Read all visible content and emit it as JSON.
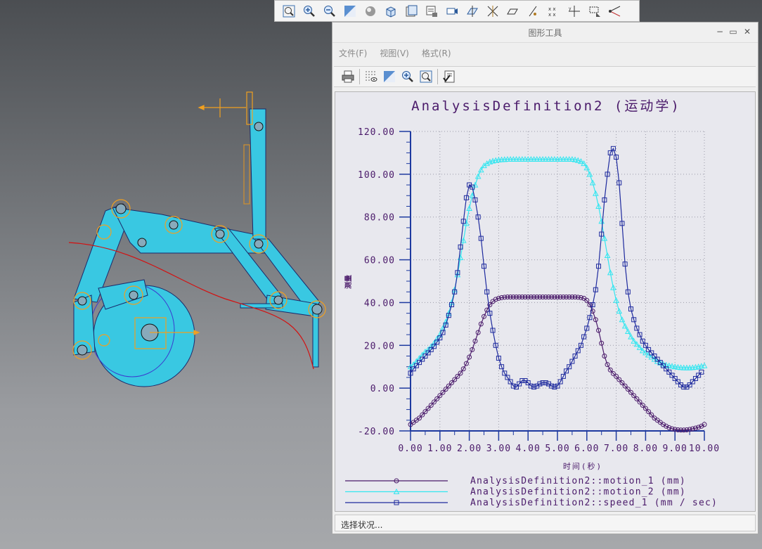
{
  "window": {
    "title": "图形工具",
    "menus": [
      "文件(F)",
      "视图(V)",
      "格式(R)"
    ],
    "status": "选择状况..."
  },
  "icons": {
    "top_toolbar": [
      "zoom-fit-icon",
      "zoom-in-icon",
      "zoom-out-icon",
      "repaint-icon",
      "shading-icon",
      "view-cube-icon",
      "saved-views-icon",
      "layers-icon",
      "camera-icon",
      "plane-display-icon",
      "axis-display-icon",
      "point-display-icon",
      "csys-display-icon",
      "annotation-display-icon",
      "spin-center-icon",
      "cut-icon",
      "vertex-icon",
      "triangle-icon",
      "blend-icon"
    ],
    "graph_toolbar": [
      "print-icon",
      "grid-icon",
      "repaint-icon",
      "zoom-in-icon",
      "refit-icon",
      "format-icon"
    ]
  },
  "chart_data": {
    "type": "line",
    "title": "AnalysisDefinition2 (运动学)",
    "xlabel": "时间(秒)",
    "ylabel": "测量",
    "xlim": [
      0,
      10
    ],
    "ylim": [
      -20,
      120
    ],
    "x_ticks": [
      "0.00",
      "1.00",
      "2.00",
      "3.00",
      "4.00",
      "5.00",
      "6.00",
      "7.00",
      "8.00",
      "9.00",
      "10.00"
    ],
    "y_ticks": [
      "-20.00",
      "0.00",
      "20.00",
      "40.00",
      "60.00",
      "80.00",
      "100.00",
      "120.00"
    ],
    "grid": true,
    "legend_position": "bottom",
    "x": [
      0,
      0.1,
      0.2,
      0.3,
      0.4,
      0.5,
      0.6,
      0.7,
      0.8,
      0.9,
      1.0,
      1.1,
      1.2,
      1.3,
      1.4,
      1.5,
      1.6,
      1.7,
      1.8,
      1.9,
      2.0,
      2.1,
      2.2,
      2.3,
      2.4,
      2.5,
      2.6,
      2.7,
      2.8,
      2.9,
      3.0,
      3.1,
      3.2,
      3.3,
      3.4,
      3.5,
      3.6,
      3.7,
      3.8,
      3.9,
      4.0,
      4.1,
      4.2,
      4.3,
      4.4,
      4.5,
      4.6,
      4.7,
      4.8,
      4.9,
      5.0,
      5.1,
      5.2,
      5.3,
      5.4,
      5.5,
      5.6,
      5.7,
      5.8,
      5.9,
      6.0,
      6.1,
      6.2,
      6.3,
      6.4,
      6.5,
      6.6,
      6.7,
      6.8,
      6.9,
      7.0,
      7.1,
      7.2,
      7.3,
      7.4,
      7.5,
      7.6,
      7.7,
      7.8,
      7.9,
      8.0,
      8.1,
      8.2,
      8.3,
      8.4,
      8.5,
      8.6,
      8.7,
      8.8,
      8.9,
      9.0,
      9.1,
      9.2,
      9.3,
      9.4,
      9.5,
      9.6,
      9.7,
      9.8,
      9.9,
      10.0
    ],
    "series": [
      {
        "name": "AnalysisDefinition2::motion_1 (mm)",
        "color": "#4a1a6a",
        "marker": "circle",
        "values": [
          -17.0,
          -16.0,
          -15.0,
          -14.0,
          -12.5,
          -11.0,
          -9.5,
          -8.0,
          -6.5,
          -5.0,
          -3.5,
          -2.0,
          -0.5,
          1.0,
          2.5,
          4.0,
          5.5,
          7.0,
          9.0,
          11.5,
          14.5,
          18.0,
          22.0,
          26.0,
          30.0,
          33.5,
          36.5,
          39.0,
          40.5,
          41.5,
          42.0,
          42.3,
          42.5,
          42.6,
          42.6,
          42.6,
          42.6,
          42.6,
          42.6,
          42.6,
          42.6,
          42.6,
          42.6,
          42.6,
          42.6,
          42.6,
          42.6,
          42.6,
          42.6,
          42.6,
          42.6,
          42.6,
          42.6,
          42.6,
          42.6,
          42.6,
          42.6,
          42.5,
          42.3,
          42.0,
          41.0,
          39.0,
          36.0,
          32.0,
          27.0,
          21.0,
          15.0,
          11.0,
          8.5,
          6.8,
          5.5,
          4.0,
          2.5,
          1.0,
          -0.5,
          -2.0,
          -3.5,
          -5.0,
          -6.5,
          -8.0,
          -9.5,
          -11.0,
          -12.5,
          -14.0,
          -15.0,
          -16.0,
          -17.0,
          -17.8,
          -18.5,
          -19.0,
          -19.3,
          -19.5,
          -19.6,
          -19.6,
          -19.5,
          -19.3,
          -19.0,
          -18.7,
          -18.3,
          -17.8,
          -17.0
        ]
      },
      {
        "name": "AnalysisDefinition2::motion_2 (mm)",
        "color": "#33e6f0",
        "marker": "triangle",
        "values": [
          10.0,
          11.0,
          12.5,
          14.0,
          15.5,
          17.0,
          18.0,
          19.5,
          21.0,
          23.0,
          25.0,
          28.0,
          31.0,
          35.0,
          40.0,
          46.0,
          53.0,
          61.0,
          69.0,
          77.0,
          84.0,
          90.0,
          95.0,
          99.0,
          102.0,
          104.0,
          105.0,
          105.8,
          106.2,
          106.5,
          106.7,
          106.8,
          106.9,
          107.0,
          107.0,
          107.0,
          107.0,
          107.0,
          107.0,
          107.0,
          107.0,
          107.0,
          107.0,
          107.0,
          107.0,
          107.0,
          107.0,
          107.0,
          107.0,
          107.0,
          107.0,
          107.0,
          107.0,
          107.0,
          107.0,
          107.0,
          106.8,
          106.5,
          106.0,
          105.0,
          103.0,
          100.0,
          96.0,
          91.0,
          85.0,
          78.0,
          70.0,
          62.0,
          54.0,
          47.0,
          41.0,
          36.0,
          32.0,
          29.0,
          26.5,
          24.0,
          22.0,
          20.5,
          19.0,
          17.5,
          16.5,
          15.5,
          14.5,
          13.5,
          12.5,
          11.8,
          11.2,
          10.8,
          10.5,
          10.3,
          10.0,
          9.8,
          9.6,
          9.5,
          9.5,
          9.5,
          9.6,
          9.8,
          10.0,
          10.3,
          10.5
        ]
      },
      {
        "name": "AnalysisDefinition2::speed_1 (mm / sec)",
        "color": "#1e2a9e",
        "marker": "square",
        "values": [
          7.0,
          9.0,
          10.5,
          12.0,
          13.5,
          15.0,
          16.5,
          18.0,
          19.5,
          21.5,
          23.5,
          26.0,
          29.5,
          34.0,
          39.0,
          45.0,
          54.0,
          66.0,
          78.0,
          89.0,
          95.0,
          94.0,
          88.0,
          80.0,
          70.0,
          57.0,
          45.0,
          35.0,
          27.0,
          20.0,
          14.0,
          10.0,
          7.0,
          5.0,
          3.0,
          1.0,
          0.5,
          2.0,
          3.5,
          3.5,
          2.5,
          1.0,
          0.5,
          1.0,
          2.0,
          2.5,
          2.5,
          2.0,
          1.0,
          0.5,
          1.0,
          3.0,
          5.5,
          8.0,
          10.0,
          12.5,
          15.0,
          17.5,
          20.0,
          24.0,
          28.0,
          33.0,
          39.0,
          46.0,
          57.0,
          72.0,
          88.0,
          100.0,
          110.0,
          112.0,
          108.0,
          96.0,
          77.0,
          58.0,
          45.0,
          37.0,
          32.0,
          28.0,
          25.0,
          22.0,
          20.0,
          18.0,
          16.5,
          15.0,
          13.5,
          12.0,
          10.5,
          9.0,
          7.5,
          6.0,
          4.5,
          3.0,
          1.5,
          0.5,
          0.5,
          1.5,
          3.0,
          4.5,
          6.0,
          7.5
        ]
      }
    ]
  }
}
